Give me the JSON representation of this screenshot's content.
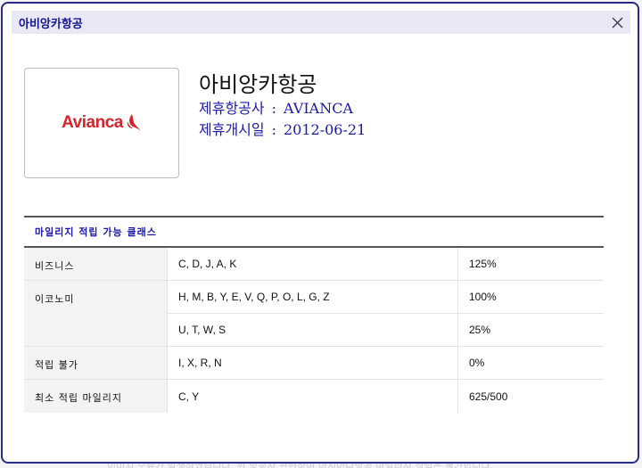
{
  "dialog": {
    "title": "아비앙카항공",
    "close_icon": "close-icon"
  },
  "airline": {
    "logo_text": "Avianca",
    "logo_icon": "avianca-bird-logo",
    "logo_color": "#d6242a",
    "name": "아비앙카항공",
    "partner_label": "제휴항공사",
    "partner_value": "AVIANCA",
    "start_label": "제휴개시일",
    "start_value": "2012-06-21",
    "separator": ":"
  },
  "classes": {
    "heading": "마일리지 적립 가능 클래스",
    "rows": [
      {
        "label": "비즈니스",
        "codes": "C, D, J, A, K",
        "rate": "125%"
      },
      {
        "label": "이코노미",
        "codes": "H, M, B, Y, E, V, Q, P, O, L, G, Z",
        "rate": "100%"
      },
      {
        "label": "",
        "codes": "U, T, W, S",
        "rate": "25%"
      },
      {
        "label": "적립 불가",
        "codes": "I, X, R, N",
        "rate": "0%"
      },
      {
        "label": "최소 적립 마일리지",
        "codes": "C, Y",
        "rate": "625/500"
      }
    ]
  },
  "colors": {
    "accent": "#1a1aa8",
    "border": "#2a2a8a",
    "titlebar": "#e9e9f6"
  },
  "background_text": "이미지 오류가 발생하였습니다. 위 항공사 관련하여 아시아나항공 마일리지 적립은 불가합니다."
}
